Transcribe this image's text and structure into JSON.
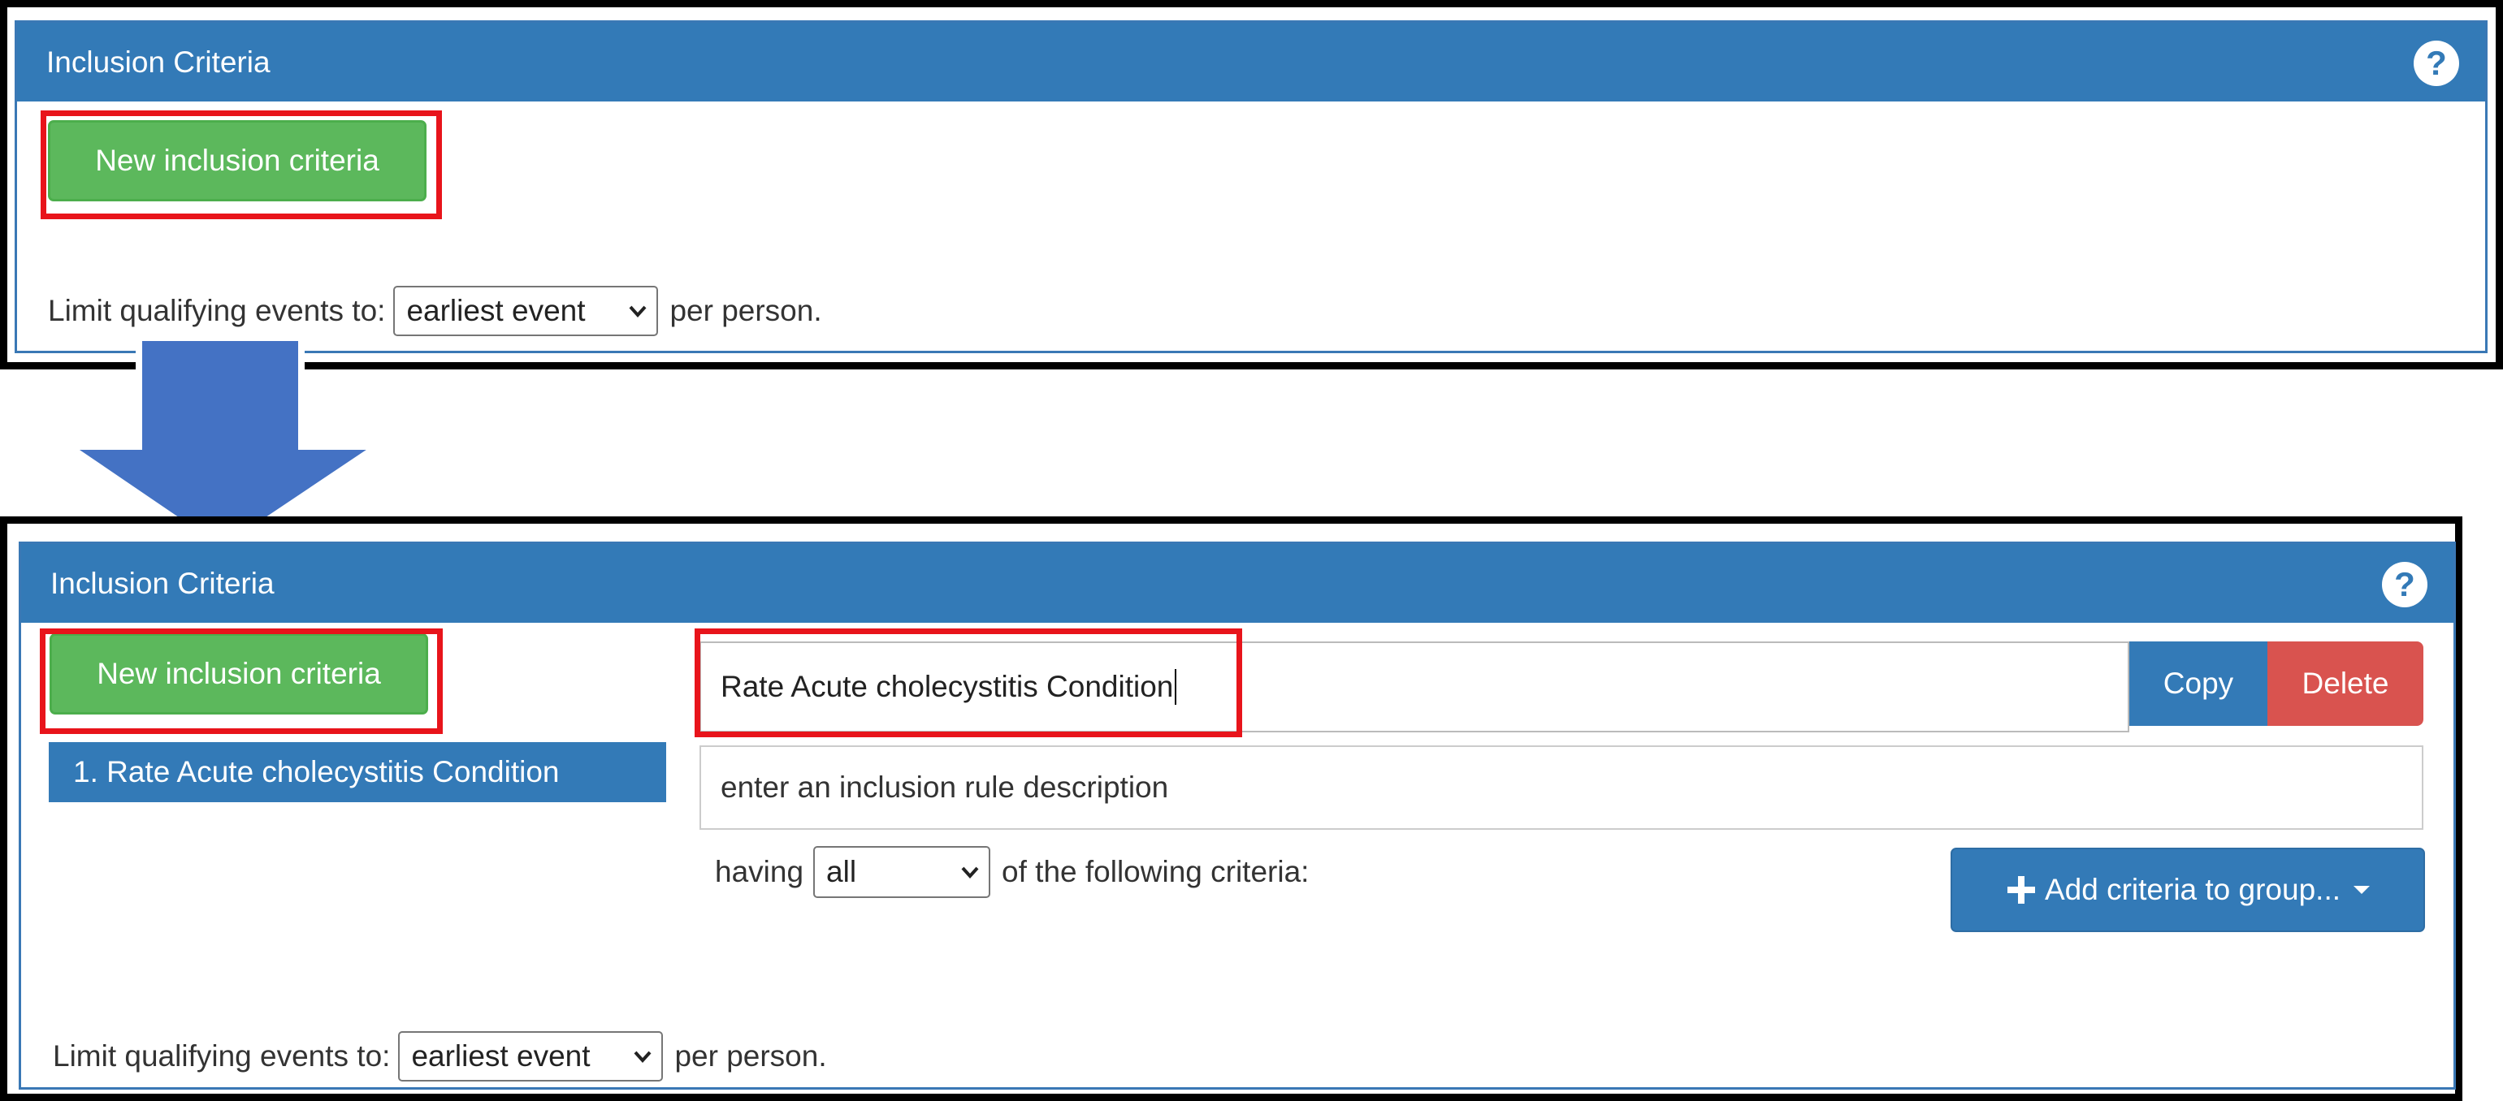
{
  "panel_title": "Inclusion Criteria",
  "help_icon": "?",
  "new_button_label": "New inclusion criteria",
  "limit": {
    "prefix": "Limit qualifying events to:",
    "value": "earliest event",
    "suffix": "per person."
  },
  "rule_list": [
    "1.  Rate Acute cholecystitis Condition"
  ],
  "rule_editor": {
    "name_value": "Rate Acute cholecystitis Condition",
    "copy_label": "Copy",
    "delete_label": "Delete",
    "description_placeholder": "enter an inclusion rule description",
    "having_prefix": "having",
    "having_value": "all",
    "having_suffix": "of the following criteria:",
    "add_button_label": "Add criteria to group..."
  },
  "colors": {
    "header_blue": "#337ab7",
    "green": "#5cb85c",
    "red": "#d9534f",
    "highlight_red": "#e8141b",
    "arrow_blue": "#4472c4"
  }
}
